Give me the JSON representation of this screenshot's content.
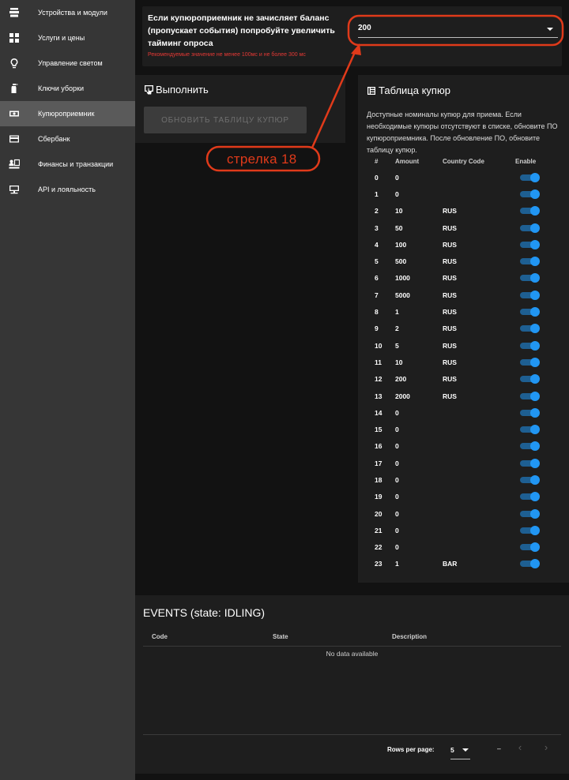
{
  "sidebar": {
    "items": [
      {
        "label": "Устройства и модули",
        "icon": "devices-icon"
      },
      {
        "label": "Услуги и цены",
        "icon": "grid-icon"
      },
      {
        "label": "Управление светом",
        "icon": "lightbulb-icon"
      },
      {
        "label": "Ключи уборки",
        "icon": "spray-bottle-icon"
      },
      {
        "label": "Купюроприемник",
        "icon": "banknote-icon",
        "active": true
      },
      {
        "label": "Сбербанк",
        "icon": "credit-card-icon"
      },
      {
        "label": "Финансы и транзакции",
        "icon": "finance-icon"
      },
      {
        "label": "API и лояльность",
        "icon": "api-icon"
      }
    ]
  },
  "setting": {
    "text": "Если купюроприемник не зачисляет баланс (пропускает события) попробуйте увеличить тайминг опроса",
    "hint": "Рекомендуемые значение не менее 100мс и не более 300 мс",
    "value": "200"
  },
  "execute": {
    "title": "Выполнить",
    "button": "ОБНОВИТЬ ТАБЛИЦУ КУПЮР"
  },
  "bills": {
    "title": "Таблица купюр",
    "description": "Доступные номиналы купюр для приема. Если необходимые купюры отсутствуют в списке, обновите ПО купюроприемника. После обновление ПО, обновите таблицу купюр.",
    "headers": [
      "#",
      "Amount",
      "Country Code",
      "Enable"
    ],
    "rows": [
      {
        "n": "0",
        "amount": "0",
        "code": "",
        "enabled": true
      },
      {
        "n": "1",
        "amount": "0",
        "code": "",
        "enabled": true
      },
      {
        "n": "2",
        "amount": "10",
        "code": "RUS",
        "enabled": true
      },
      {
        "n": "3",
        "amount": "50",
        "code": "RUS",
        "enabled": true
      },
      {
        "n": "4",
        "amount": "100",
        "code": "RUS",
        "enabled": true
      },
      {
        "n": "5",
        "amount": "500",
        "code": "RUS",
        "enabled": true
      },
      {
        "n": "6",
        "amount": "1000",
        "code": "RUS",
        "enabled": true
      },
      {
        "n": "7",
        "amount": "5000",
        "code": "RUS",
        "enabled": true
      },
      {
        "n": "8",
        "amount": "1",
        "code": "RUS",
        "enabled": true
      },
      {
        "n": "9",
        "amount": "2",
        "code": "RUS",
        "enabled": true
      },
      {
        "n": "10",
        "amount": "5",
        "code": "RUS",
        "enabled": true
      },
      {
        "n": "11",
        "amount": "10",
        "code": "RUS",
        "enabled": true
      },
      {
        "n": "12",
        "amount": "200",
        "code": "RUS",
        "enabled": true
      },
      {
        "n": "13",
        "amount": "2000",
        "code": "RUS",
        "enabled": true
      },
      {
        "n": "14",
        "amount": "0",
        "code": "",
        "enabled": true
      },
      {
        "n": "15",
        "amount": "0",
        "code": "",
        "enabled": true
      },
      {
        "n": "16",
        "amount": "0",
        "code": "",
        "enabled": true
      },
      {
        "n": "17",
        "amount": "0",
        "code": "",
        "enabled": true
      },
      {
        "n": "18",
        "amount": "0",
        "code": "",
        "enabled": true
      },
      {
        "n": "19",
        "amount": "0",
        "code": "",
        "enabled": true
      },
      {
        "n": "20",
        "amount": "0",
        "code": "",
        "enabled": true
      },
      {
        "n": "21",
        "amount": "0",
        "code": "",
        "enabled": true
      },
      {
        "n": "22",
        "amount": "0",
        "code": "",
        "enabled": true
      },
      {
        "n": "23",
        "amount": "1",
        "code": "BAR",
        "enabled": true
      }
    ]
  },
  "events": {
    "title": "EVENTS (state: IDLING)",
    "headers": [
      "Code",
      "State",
      "Description"
    ],
    "empty": "No data available",
    "rows_per_page_label": "Rows per page:",
    "rows_per_page": "5",
    "range": "–"
  },
  "annotation": {
    "label": "стрелка 18",
    "color": "#e03a1a"
  },
  "colors": {
    "accent": "#2196f3",
    "error": "#e53935",
    "sidebar": "#363636",
    "card": "#1e1e1e",
    "background": "#121212"
  }
}
